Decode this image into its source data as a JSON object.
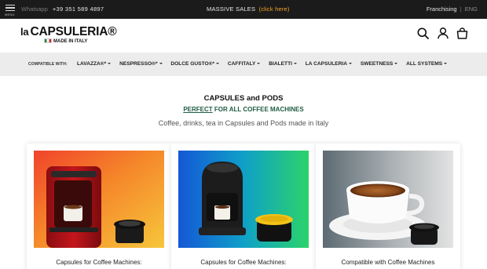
{
  "topbar": {
    "menu_label": "MENU",
    "whatsapp_label": "Whatsapp",
    "phone": "+39 351 589 4897",
    "promo_text": "MASSIVE SALES",
    "promo_cta": "(click here)",
    "franchising": "Franchising",
    "separator": "|",
    "language": "ENG"
  },
  "header": {
    "logo_prefix": "la",
    "logo_name": "CAPSULERIA®",
    "logo_tagline": "MADE IN ITALY",
    "icons": [
      "search-icon",
      "user-icon",
      "cart-icon"
    ]
  },
  "nav": {
    "compat_label": "COMPATIBLE WITH:",
    "items": [
      {
        "label": "LAVAZZA®*"
      },
      {
        "label": "NESPRESSO®*"
      },
      {
        "label": "DOLCE GUSTO®*"
      },
      {
        "label": "CAFFITALY"
      },
      {
        "label": "BIALETTI"
      },
      {
        "label": "LA CAPSULERIA"
      },
      {
        "label": "SWEETNESS"
      },
      {
        "label": "ALL SYSTEMS"
      }
    ]
  },
  "hero": {
    "title": "CAPSULES and PODS",
    "subtitle_em": "PERFECT",
    "subtitle_rest": "FOR ALL COFFEE MACHINES",
    "description": "Coffee, drinks, tea in Capsules and Pods made in Italy"
  },
  "cards": [
    {
      "caption": "Capsules for Coffee Machines:"
    },
    {
      "caption": "Capsules for Coffee Machines:"
    },
    {
      "caption": "Compatible with Coffee Machines"
    }
  ],
  "colors": {
    "topbar_bg": "#1b1b1b",
    "promo_accent": "#f5a623",
    "nav_bg": "#ececec",
    "subtitle_green": "#1f5c43"
  }
}
